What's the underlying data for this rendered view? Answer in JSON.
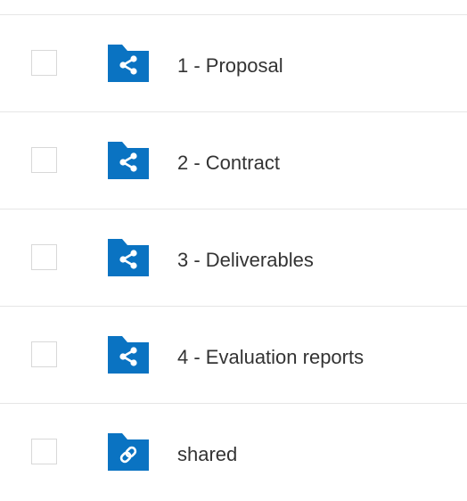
{
  "files": [
    {
      "name": "1 - Proposal",
      "type": "folder",
      "icon": "shared-folder-icon"
    },
    {
      "name": "2 - Contract",
      "type": "folder",
      "icon": "shared-folder-icon"
    },
    {
      "name": "3 - Deliverables",
      "type": "folder",
      "icon": "shared-folder-icon"
    },
    {
      "name": "4 - Evaluation reports",
      "type": "folder",
      "icon": "shared-folder-icon"
    },
    {
      "name": "shared",
      "type": "folder",
      "icon": "link-folder-icon"
    }
  ],
  "colors": {
    "folder": "#0a73c2",
    "divider": "#e6e6e6",
    "text": "#333333"
  }
}
